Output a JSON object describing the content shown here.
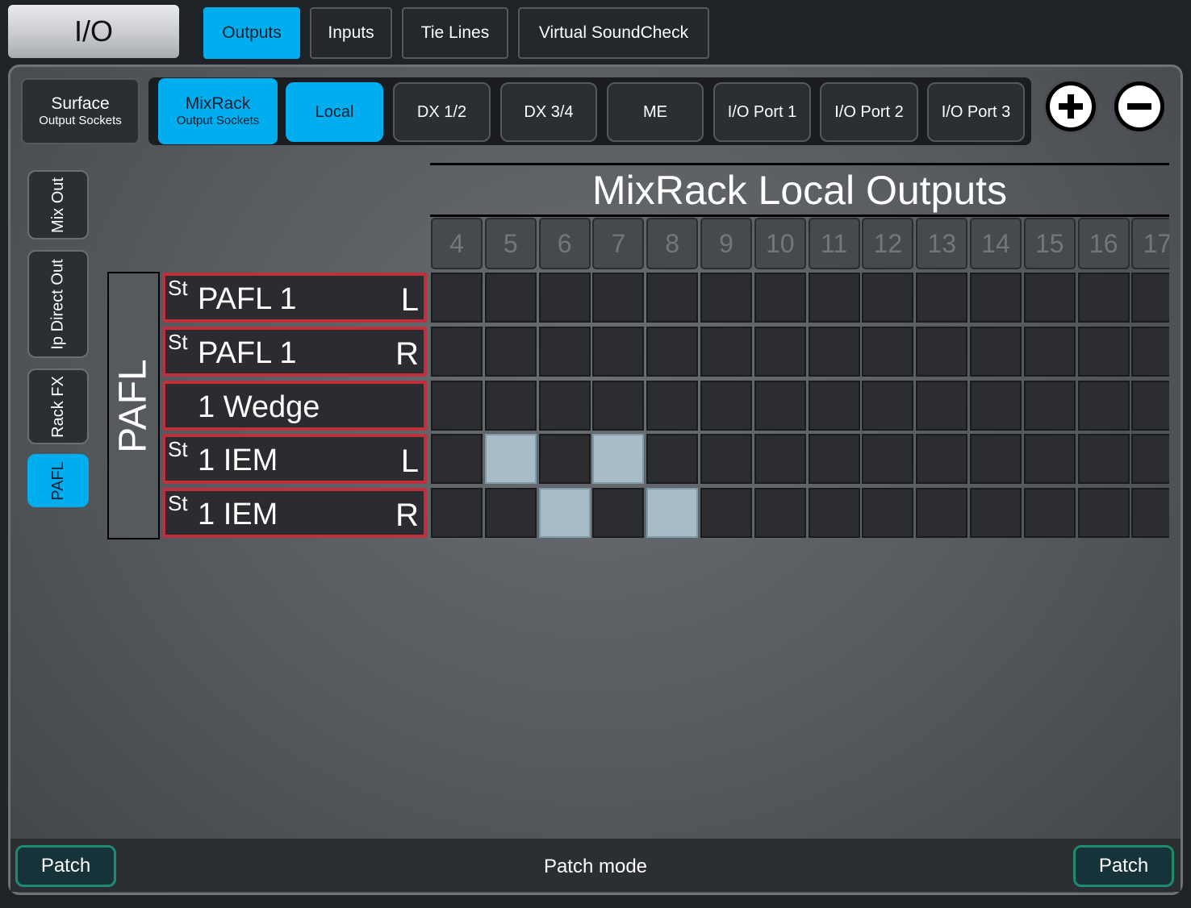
{
  "title": "I/O",
  "top_tabs": [
    {
      "label": "Outputs",
      "active": true
    },
    {
      "label": "Inputs",
      "active": false
    },
    {
      "label": "Tie Lines",
      "active": false
    },
    {
      "label": "Virtual SoundCheck",
      "active": false
    }
  ],
  "socket_buttons": {
    "surface": {
      "line1": "Surface",
      "line2": "Output Sockets"
    },
    "mixrack": {
      "line1": "MixRack",
      "line2": "Output Sockets"
    }
  },
  "output_tabs": [
    "Local",
    "DX 1/2",
    "DX 3/4",
    "ME",
    "I/O Port 1",
    "I/O Port 2",
    "I/O Port 3"
  ],
  "output_tab_active": "Local",
  "side_tabs": [
    "Mix Out",
    "Ip Direct Out",
    "Rack FX",
    "PAFL"
  ],
  "side_tab_active": "PAFL",
  "group_label": "PAFL",
  "rows": [
    {
      "prefix": "St",
      "name": "PAFL 1",
      "side": "L"
    },
    {
      "prefix": "St",
      "name": "PAFL 1",
      "side": "R"
    },
    {
      "prefix": "",
      "name": "1 Wedge",
      "side": ""
    },
    {
      "prefix": "St",
      "name": "1 IEM",
      "side": "L"
    },
    {
      "prefix": "St",
      "name": "1 IEM",
      "side": "R"
    }
  ],
  "matrix": {
    "header": "MixRack Local Outputs",
    "columns": [
      "4",
      "5",
      "6",
      "7",
      "8",
      "9",
      "10",
      "11",
      "12",
      "13",
      "14",
      "15",
      "16",
      "17"
    ],
    "patched": [
      {
        "row": 3,
        "col": "5"
      },
      {
        "row": 3,
        "col": "7"
      },
      {
        "row": 4,
        "col": "6"
      },
      {
        "row": 4,
        "col": "8"
      }
    ]
  },
  "bottom": {
    "left_button": "Patch",
    "right_button": "Patch",
    "status": "Patch mode"
  },
  "colors": {
    "accent": "#00aeef",
    "patched_cell": "#a8bcc7",
    "row_border": "#c0303a",
    "patch_button_border": "#1e8a6e"
  }
}
